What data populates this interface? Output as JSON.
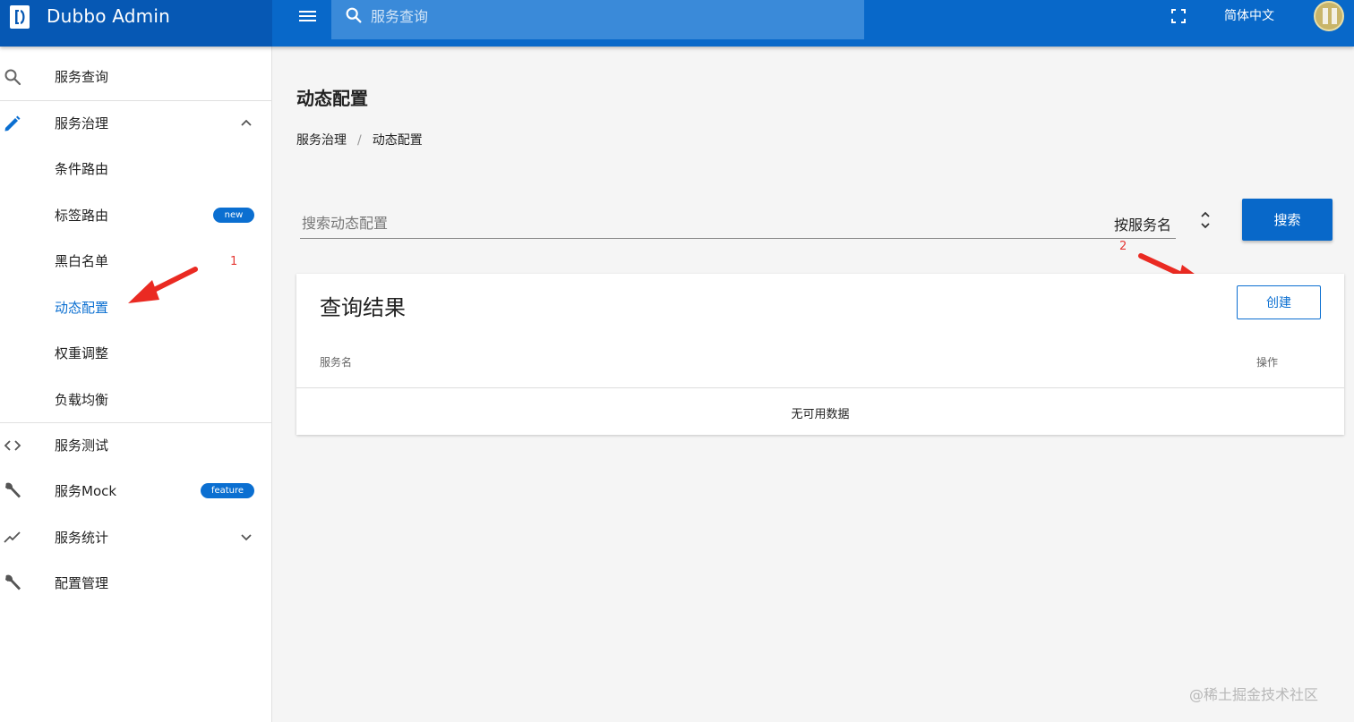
{
  "app": {
    "title": "Dubbo Admin",
    "search_placeholder": "服务查询",
    "language": "简体中文"
  },
  "sidebar": {
    "items": [
      {
        "label": "服务查询",
        "icon": "search-icon"
      },
      {
        "label": "服务治理",
        "icon": "pencil-icon",
        "expanded": true
      },
      {
        "label": "条件路由"
      },
      {
        "label": "标签路由",
        "badge": "new"
      },
      {
        "label": "黑白名单"
      },
      {
        "label": "动态配置",
        "active": true
      },
      {
        "label": "权重调整"
      },
      {
        "label": "负载均衡"
      },
      {
        "label": "服务测试",
        "icon": "code-icon"
      },
      {
        "label": "服务Mock",
        "icon": "wrench-icon",
        "badge": "feature"
      },
      {
        "label": "服务统计",
        "icon": "trending-icon",
        "expanded": false
      },
      {
        "label": "配置管理",
        "icon": "wrench-icon"
      }
    ]
  },
  "annotations": {
    "marker_1": "1",
    "marker_2": "2"
  },
  "main": {
    "title": "动态配置",
    "breadcrumb": [
      "服务治理",
      "/",
      "动态配置"
    ],
    "filter": {
      "placeholder": "搜索动态配置",
      "select_value": "按服务名",
      "search_label": "搜索"
    },
    "results": {
      "title": "查询结果",
      "create_label": "创建",
      "columns": [
        "服务名",
        "操作"
      ],
      "empty_text": "无可用数据"
    }
  },
  "watermark": "@稀土掘金技术社区",
  "colors": {
    "primary": "#0868c9",
    "primary_dark": "#0658b4",
    "accent_text": "#0b6fd1",
    "annotation_red": "#e53935"
  }
}
